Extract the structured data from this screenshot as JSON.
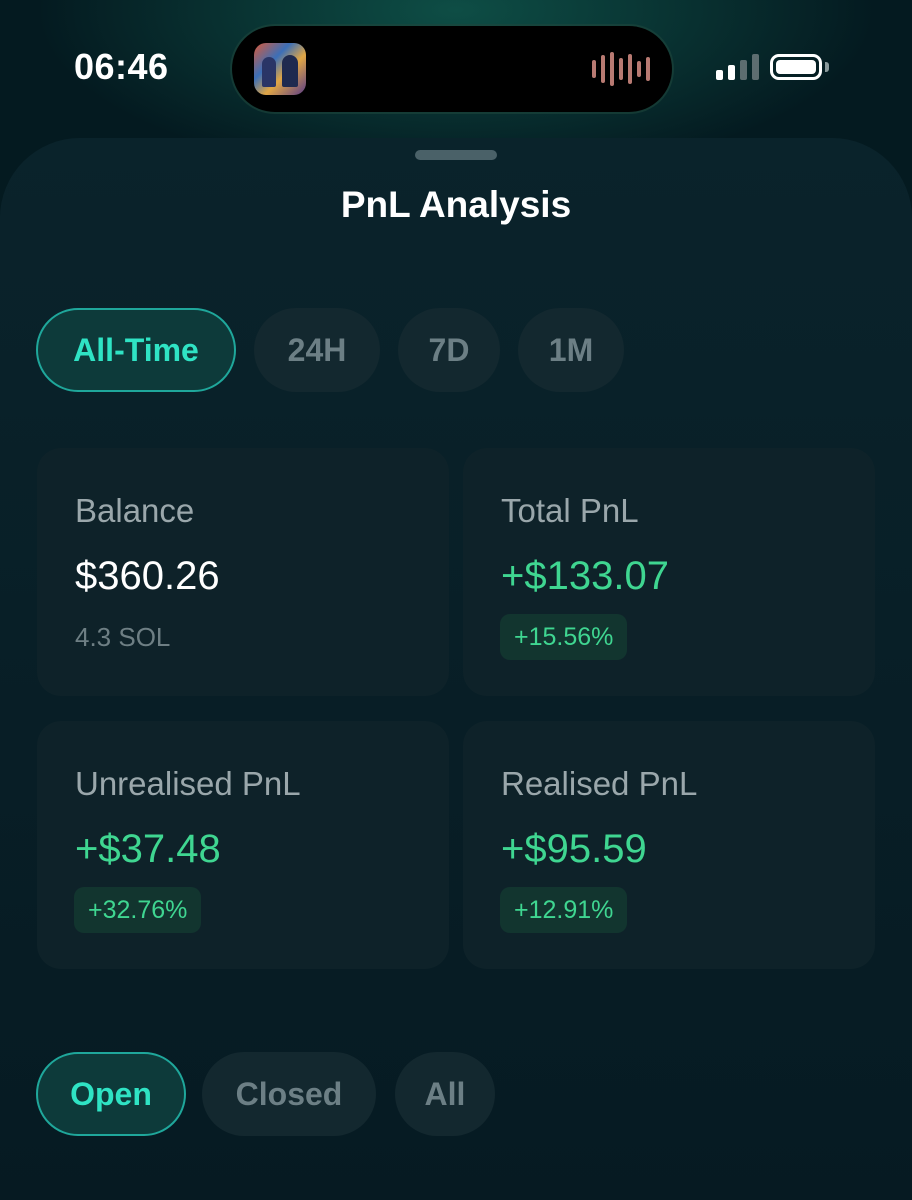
{
  "status_bar": {
    "time": "06:46"
  },
  "sheet": {
    "title": "PnL Analysis"
  },
  "time_filters": [
    {
      "label": "All-Time",
      "active": true
    },
    {
      "label": "24H",
      "active": false
    },
    {
      "label": "7D",
      "active": false
    },
    {
      "label": "1M",
      "active": false
    }
  ],
  "cards": {
    "balance": {
      "label": "Balance",
      "value": "$360.26",
      "sub": "4.3 SOL"
    },
    "total_pnl": {
      "label": "Total PnL",
      "value": "+$133.07",
      "badge": "+15.56%"
    },
    "unrealised_pnl": {
      "label": "Unrealised PnL",
      "value": "+$37.48",
      "badge": "+32.76%"
    },
    "realised_pnl": {
      "label": "Realised PnL",
      "value": "+$95.59",
      "badge": "+12.91%"
    }
  },
  "position_filters": [
    {
      "label": "Open",
      "active": true
    },
    {
      "label": "Closed",
      "active": false
    },
    {
      "label": "All",
      "active": false
    }
  ],
  "colors": {
    "accent": "#2fe3c4",
    "positive": "#3fd691",
    "background": "#061a22",
    "card": "#0e2229"
  },
  "icons": {
    "now_playing_artwork": "album-art-icon",
    "audio_wave": "waveform-icon",
    "signal": "cellular-signal-icon",
    "battery": "battery-icon"
  }
}
